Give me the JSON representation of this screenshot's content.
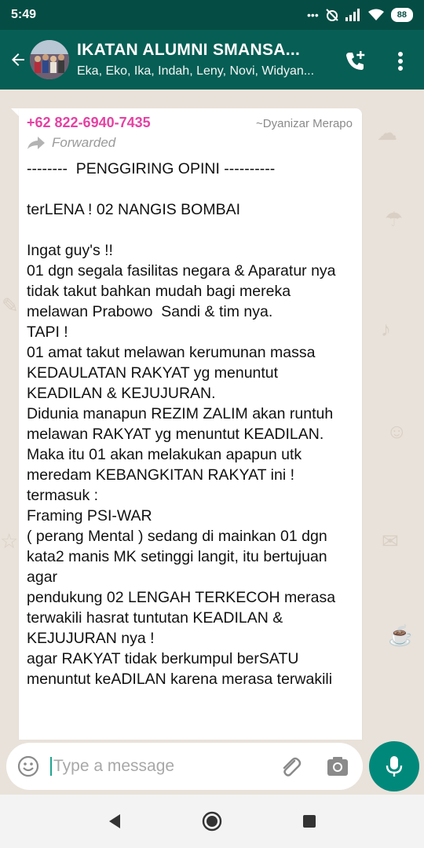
{
  "status_bar": {
    "time": "5:49",
    "battery": "88",
    "icons": [
      "more-dots-icon",
      "alarm-off-icon",
      "signal-icon",
      "wifi-icon",
      "battery-icon"
    ]
  },
  "header": {
    "title": "IKATAN ALUMNI SMANSA...",
    "subtitle": "Eka, Eko, Ika, Indah, Leny, Novi, Widyan...",
    "icons": [
      "back-arrow-icon",
      "group-avatar",
      "add-call-icon",
      "more-vertical-icon"
    ]
  },
  "message": {
    "sender_phone": "+62 822-6940-7435",
    "sender_name": "~Dyanizar Merapo",
    "forwarded_label": "Forwarded",
    "text": "--------  PENGGIRING OPINI ----------\n\nterLENA ! 02 NANGIS BOMBAI\n\nIngat guy's !!\n01 dgn segala fasilitas negara & Aparatur nya tidak takut bahkan mudah bagi mereka melawan Prabowo  Sandi & tim nya.\nTAPI !\n01 amat takut melawan kerumunan massa KEDAULATAN RAKYAT yg menuntut KEADILAN & KEJUJURAN.\nDidunia manapun REZIM ZALIM akan runtuh melawan RAKYAT yg menuntut KEADILAN.\nMaka itu 01 akan melakukan apapun utk meredam KEBANGKITAN RAKYAT ini !\ntermasuk :\nFraming PSI-WAR\n( perang Mental ) sedang di mainkan 01 dgn kata2 manis MK setinggi langit, itu bertujuan agar\npendukung 02 LENGAH TERKECOH merasa terwakili hasrat tuntutan KEADILAN & KEJUJURAN nya !\nagar RAKYAT tidak berkumpul berSATU menuntut keADILAN karena merasa terwakili"
  },
  "composer": {
    "placeholder": "Type a message",
    "value": ""
  },
  "colors": {
    "header": "#075e54",
    "status_bar": "#054d44",
    "sender_phone": "#e542a3",
    "mic_button": "#00897b",
    "chat_background": "#e9e2da"
  },
  "nav": {
    "icons": [
      "nav-back-icon",
      "nav-home-icon",
      "nav-recents-icon"
    ]
  }
}
